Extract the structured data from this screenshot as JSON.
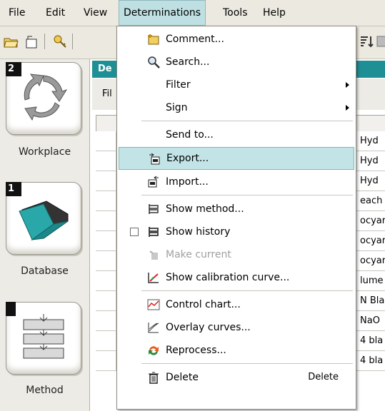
{
  "menubar": {
    "items": [
      "File",
      "Edit",
      "View",
      "Determinations",
      "Tools",
      "Help"
    ]
  },
  "left_panel": {
    "tiles": [
      {
        "badge": "2",
        "label": "Workplace",
        "icon": "workplace-cycle-icon"
      },
      {
        "badge": "1",
        "label": "Database",
        "icon": "database-folder-icon"
      },
      {
        "badge": "",
        "label": "Method",
        "icon": "method-flow-icon"
      }
    ]
  },
  "main": {
    "title": "De",
    "filter_label": "Fil",
    "rows": [
      "Hyd",
      "Hyd",
      "Hyd",
      "each",
      "ocyar",
      "ocyar",
      "ocyar",
      "lume",
      "N Bla",
      "NaO",
      "4 bla",
      "4 bla"
    ]
  },
  "determinations_menu": {
    "items": [
      {
        "label": "Comment...",
        "icon": "comment-icon"
      },
      {
        "label": "Search...",
        "icon": "search-icon"
      },
      {
        "label": "Filter",
        "submenu": true
      },
      {
        "label": "Sign",
        "submenu": true
      },
      {
        "label": "Send to..."
      },
      {
        "label": "Export...",
        "icon": "export-icon",
        "highlighted": true
      },
      {
        "label": "Import...",
        "icon": "import-icon"
      },
      {
        "label": "Show method...",
        "icon": "show-method-icon"
      },
      {
        "label": "Show history",
        "icon": "show-history-icon",
        "checkbox": true
      },
      {
        "label": "Make current",
        "icon": "make-current-icon",
        "disabled": true
      },
      {
        "label": "Show calibration curve...",
        "icon": "calibration-curve-icon"
      },
      {
        "label": "Control chart...",
        "icon": "control-chart-icon"
      },
      {
        "label": "Overlay curves...",
        "icon": "overlay-curves-icon"
      },
      {
        "label": "Reprocess...",
        "icon": "reprocess-icon"
      },
      {
        "label": "Delete",
        "icon": "delete-icon",
        "shortcut": "Delete"
      }
    ]
  },
  "colors": {
    "accent": "#1e8f94",
    "highlight": "#c3e4e7",
    "menubar_bg": "#ece9e0"
  }
}
